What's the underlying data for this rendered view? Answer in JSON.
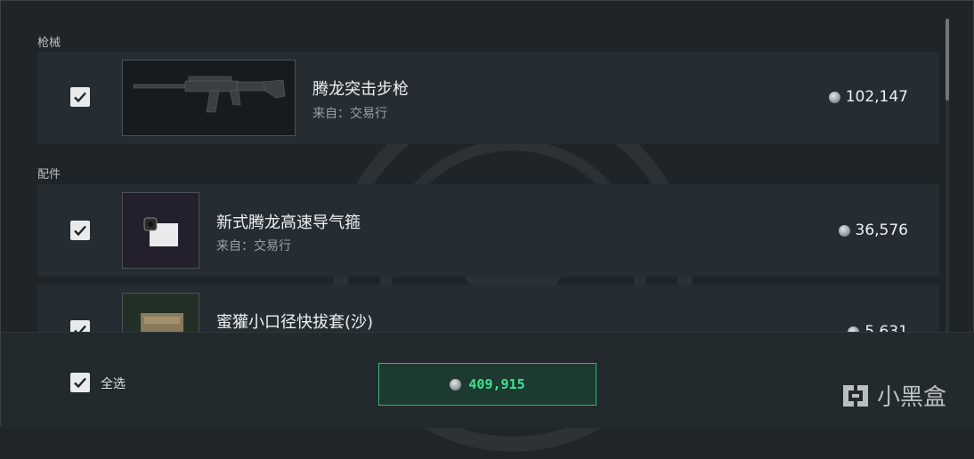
{
  "sections": {
    "guns_label": "枪械",
    "parts_label": "配件"
  },
  "items": [
    {
      "name": "腾龙突击步枪",
      "source": "来自：交易行",
      "price": "102,147",
      "checked": true
    },
    {
      "name": "新式腾龙高速导气箍",
      "source": "来自：交易行",
      "price": "36,576",
      "checked": true
    },
    {
      "name": "蜜獾小口径快拔套(沙)",
      "source": "",
      "price": "5,631",
      "checked": true
    }
  ],
  "footer": {
    "select_all_label": "全选",
    "total": "409,915"
  },
  "watermark": {
    "text": "小黑盒"
  },
  "icons": [
    "check-icon",
    "coin-icon",
    "rifle-image",
    "gas-block-image",
    "quick-detach-image",
    "heybox-logo-icon"
  ]
}
